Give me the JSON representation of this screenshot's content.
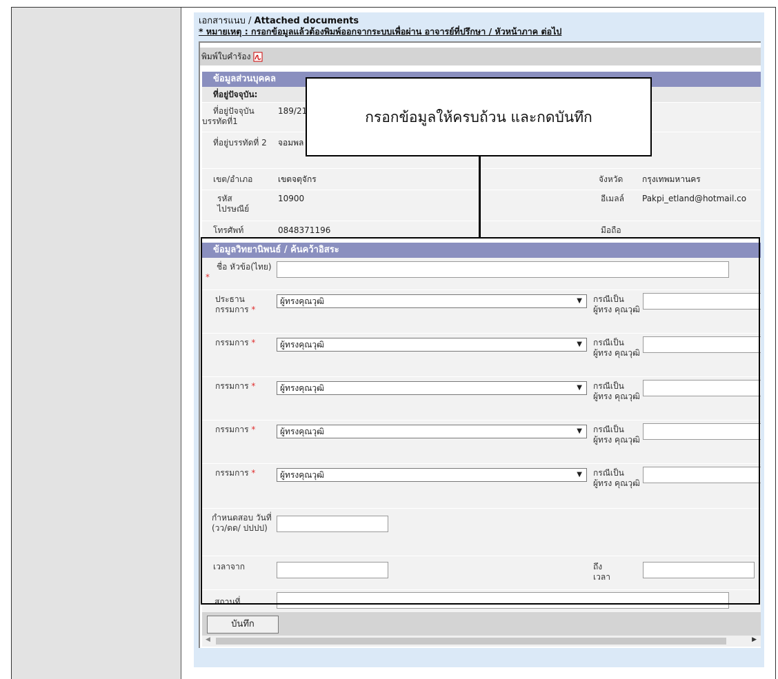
{
  "header": {
    "attached_docs": "เอกสารแนบ / ",
    "attached_docs_en": "Attached documents",
    "note": "* หมายเหตุ : กรอกข้อมูลแล้วต้องพิมพ์ออกจากระบบเพื่อผ่าน อาจารย์ที่ปรึกษา / หัวหน้าภาค ต่อไป"
  },
  "print": {
    "label": "พิมพ์ใบคำร้อง",
    "icon": "pdf-icon"
  },
  "personal": {
    "section_title": "ข้อมูลส่วนบุคคล",
    "address_heading": "ที่อยู่ปัจจุบัน:",
    "address1_label": "ที่อยู่ปัจจุบัน บรรทัดที่1",
    "address1_value": "189/21",
    "address2_label": "ที่อยู่บรรทัดที่ 2",
    "address2_value": "จอมพล",
    "district_label": "เขต/อำเภอ",
    "district_value": "เขตจตุจักร",
    "province_label": "จังหวัด",
    "province_value": "กรุงเทพมหานคร",
    "postal_label": "รหัส ไปรษณีย์",
    "postal_value": "10900",
    "email_label": "อีเมลล์",
    "email_value": "Pakpi_etland@hotmail.co",
    "phone_label": "โทรศัพท์",
    "phone_value": "0848371196",
    "mobile_label": "มือถือ"
  },
  "thesis": {
    "section_title": "ข้อมูลวิทยานิพนธ์ / ค้นคว้าอิสระ",
    "title_label": "ชื่อ หัวข้อ(ไทย)",
    "required_mark": "*",
    "chair_label": "ประธาน กรรมการ",
    "member_label": "กรรมการ",
    "select_value": "ผู้ทรงคุณวุฒิ",
    "expert_label": "กรณีเป็น ผู้ทรง คุณวุฒิ",
    "exam_date_label": "กำหนดสอบ วันที่ (วว/ดด/ ปปปป)",
    "time_from_label": "เวลาจาก",
    "time_to_label": "ถึง เวลา",
    "place_label": "สถานที่"
  },
  "actions": {
    "save_label": "บันทึก"
  },
  "callout": {
    "text": "กรอกข้อมูลให้ครบถ้วน และกดบันทึก"
  },
  "colors": {
    "section_header": "#8a8fbf",
    "content_bg": "#dbe9f7",
    "required": "#e03030"
  }
}
